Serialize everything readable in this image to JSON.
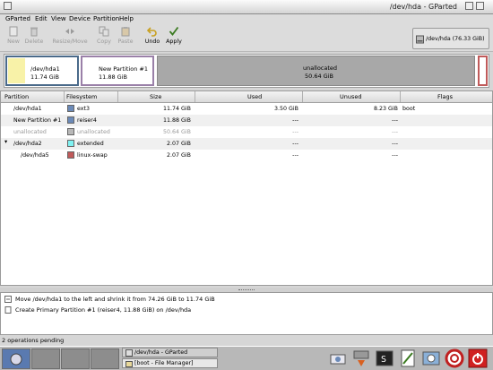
{
  "window": {
    "title": "/dev/hda - GParted"
  },
  "menu": [
    "GParted",
    "Edit",
    "View",
    "Device",
    "Partition",
    "Help"
  ],
  "toolbar": {
    "new": "New",
    "delete": "Delete",
    "resize_move": "Resize/Move",
    "copy": "Copy",
    "paste": "Paste",
    "undo": "Undo",
    "apply": "Apply"
  },
  "device_selector": {
    "label": "/dev/hda  (76.33 GiB)"
  },
  "partition_bar": [
    {
      "name": "/dev/hda1",
      "size": "11.74 GiB",
      "color": "#f8f2a8"
    },
    {
      "name": "New Partition #1",
      "size": "11.88 GiB",
      "color": "#ffffff"
    },
    {
      "name": "unallocated",
      "size": "50.64 GiB",
      "color": "#a8a8a8"
    }
  ],
  "table": {
    "headers": [
      "Partition",
      "Filesystem",
      "Size",
      "Used",
      "Unused",
      "Flags"
    ],
    "rows": [
      {
        "partition": "/dev/hda1",
        "fs": "ext3",
        "fs_color": "#6b8ab8",
        "size": "11.74 GiB",
        "used": "3.50 GiB",
        "unused": "8.23 GiB",
        "flags": "boot",
        "indent": 1,
        "expander": "",
        "dim": false
      },
      {
        "partition": "New Partition #1",
        "fs": "reiser4",
        "fs_color": "#6b8ab8",
        "size": "11.88 GiB",
        "used": "---",
        "unused": "---",
        "flags": "",
        "indent": 1,
        "expander": "",
        "dim": false
      },
      {
        "partition": "unallocated",
        "fs": "unallocated",
        "fs_color": "#b8b8b8",
        "size": "50.64 GiB",
        "used": "---",
        "unused": "---",
        "flags": "",
        "indent": 1,
        "expander": "",
        "dim": true
      },
      {
        "partition": "/dev/hda2",
        "fs": "extended",
        "fs_color": "#7ff2f2",
        "size": "2.07 GiB",
        "used": "---",
        "unused": "---",
        "flags": "",
        "indent": 1,
        "expander": "▾",
        "dim": false
      },
      {
        "partition": "/dev/hda5",
        "fs": "linux-swap",
        "fs_color": "#c05a5a",
        "size": "2.07 GiB",
        "used": "---",
        "unused": "---",
        "flags": "",
        "indent": 2,
        "expander": "",
        "dim": false
      }
    ]
  },
  "operations": [
    "Move /dev/hda1 to the left and shrink it from 74.26 GiB to 11.74 GiB",
    "Create Primary Partition #1 (reiser4, 11.88 GiB) on /dev/hda"
  ],
  "status": "2 operations pending",
  "taskbar": {
    "tasks": [
      "/dev/hda - GParted",
      "[boot - File Manager]"
    ]
  }
}
